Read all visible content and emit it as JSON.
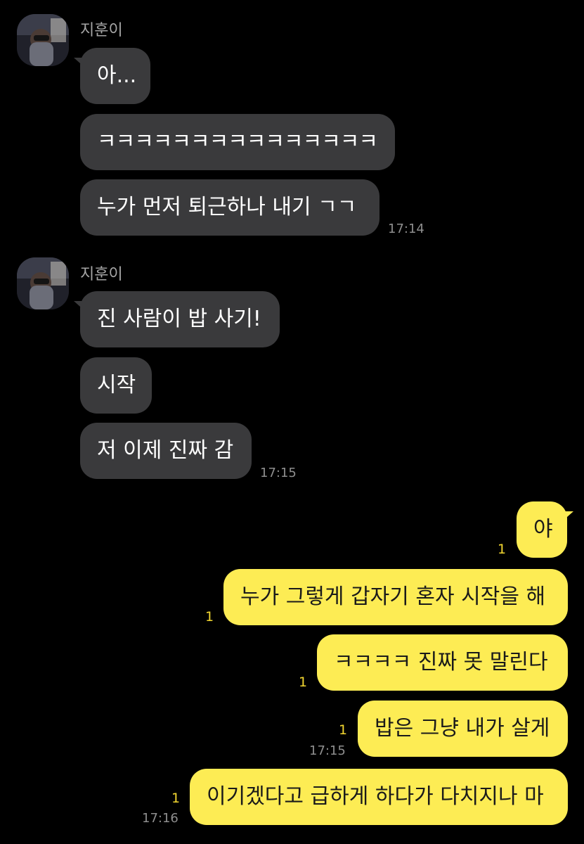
{
  "chat": {
    "groups": [
      {
        "sender": "지훈이",
        "messages": [
          "아...",
          "ㅋㅋㅋㅋㅋㅋㅋㅋㅋㅋㅋㅋㅋㅋㅋ",
          "누가 먼저 퇴근하나 내기 ㄱㄱ"
        ],
        "time": "17:14"
      },
      {
        "sender": "지훈이",
        "messages": [
          "진 사람이 밥 사기!",
          "시작",
          "저 이제 진짜 감"
        ],
        "time": "17:15"
      }
    ],
    "sent": [
      {
        "text": "야",
        "unread": "1",
        "time": ""
      },
      {
        "text": "누가 그렇게 갑자기 혼자 시작을 해",
        "unread": "1",
        "time": ""
      },
      {
        "text": "ㅋㅋㅋㅋ 진짜 못 말린다",
        "unread": "1",
        "time": ""
      },
      {
        "text": "밥은 그냥 내가 살게",
        "unread": "1",
        "time": "17:15"
      },
      {
        "text": "이기겠다고 급하게 하다가 다치지나 마",
        "unread": "1",
        "time": "17:16"
      }
    ]
  },
  "colors": {
    "background": "#000000",
    "incoming_bubble": "#3a3a3c",
    "outgoing_bubble": "#fdec54",
    "unread_count": "#f2d630",
    "timestamp": "#8e8e8e"
  },
  "icons": {
    "avatar": "profile-photo"
  }
}
